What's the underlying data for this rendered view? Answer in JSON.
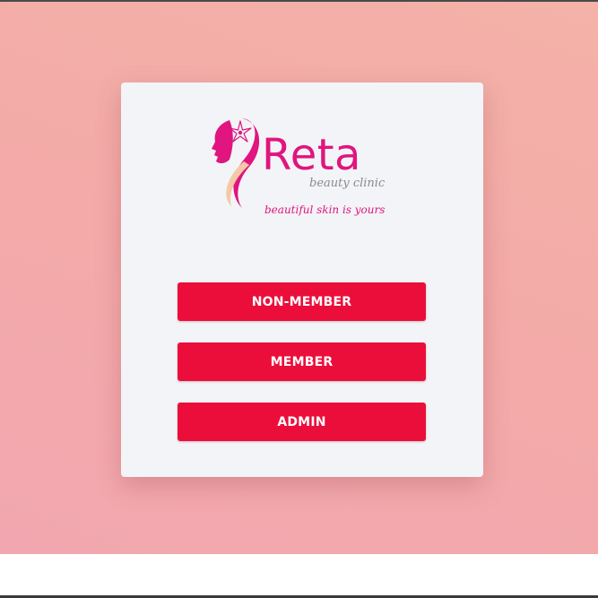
{
  "brand": {
    "name": "Reta",
    "subtitle": "beauty clinic",
    "tagline": "beautiful skin is yours",
    "colors": {
      "primary": "#e0157f",
      "secondary": "#8a8a8a",
      "accent": "#f3c9a6"
    }
  },
  "login_options": {
    "non_member_label": "NON-MEMBER",
    "member_label": "MEMBER",
    "admin_label": "ADMIN"
  },
  "theme": {
    "button_color": "#eb0e3b",
    "card_color": "#f3f4f7",
    "background_start": "#f4b2a8",
    "background_end": "#f2a7b0"
  }
}
